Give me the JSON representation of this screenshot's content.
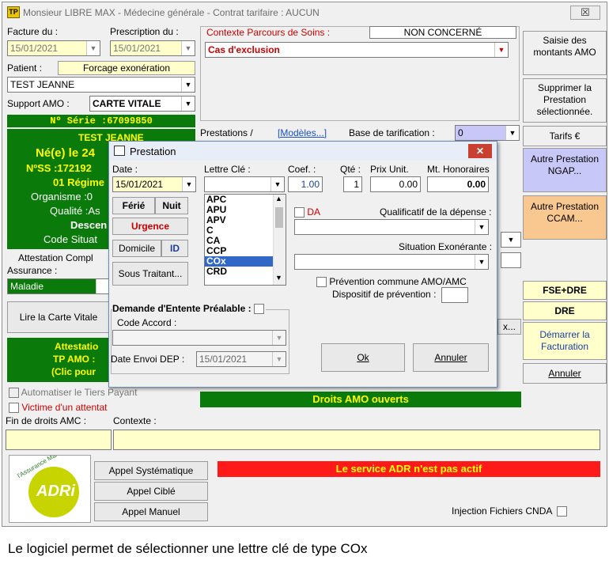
{
  "window": {
    "title": "Monsieur LIBRE MAX - Médecine générale - Contrat tarifaire : AUCUN",
    "close": "☒"
  },
  "left": {
    "facture_label": "Facture du :",
    "facture_value": "15/01/2021",
    "prescription_label": "Prescription du :",
    "prescription_value": "15/01/2021",
    "patient_label": "Patient :",
    "forcage": "Forcage exonération",
    "patient_value": "TEST JEANNE",
    "support_label": "Support AMO :",
    "support_value": "CARTE VITALE",
    "serie": "Nº Série :67099850",
    "green_lines": [
      "TEST JEANNE",
      "Né(e) le 24",
      "NºSS :172192",
      "01 Régime",
      "Organisme :0",
      "Qualité :As",
      "Descen",
      "Code Situat"
    ],
    "attestation": "Attestation Compl",
    "assurance_label": "Assurance :",
    "assurance_value": "Maladie",
    "lire_carte": "Lire la Carte Vitale",
    "attestatio_box": [
      "Attestatio",
      "TP AMO :",
      "(Clic pour"
    ],
    "auto_tiers": "Automatiser le Tiers Payant",
    "victime": "Victime d'un attentat",
    "fin_droits": "Fin de droits AMC :",
    "contexte": "Contexte :"
  },
  "center": {
    "parcours_label": "Contexte Parcours de Soins :",
    "parcours_value": "NON CONCERNÉ",
    "cas_exclusion": "Cas d'exclusion",
    "prestations": "Prestations /",
    "modeles": "[Modèles...]",
    "base_tarif": "Base de tarification :",
    "base_value": "0",
    "droits": "Droits AMO ouverts",
    "modif_btn": "x..."
  },
  "right": {
    "saisie": "Saisie des montants AMO",
    "supprimer": "Supprimer la Prestation sélectionnée.",
    "tarifs": "Tarifs €",
    "autre_ngap": "Autre Prestation NGAP...",
    "autre_ccam": "Autre Prestation CCAM...",
    "fse_dre": "FSE+DRE",
    "dre": "DRE",
    "demarrer": "Démarrer la Facturation",
    "annuler": "Annuler"
  },
  "dialog": {
    "title": "Prestation",
    "close": "✕",
    "date_label": "Date :",
    "date_value": "15/01/2021",
    "lettre_label": "Lettre Clé :",
    "coef_label": "Coef. :",
    "coef_value": "1.00",
    "qte_label": "Qté :",
    "qte_value": "1",
    "prix_label": "Prix Unit.",
    "prix_value": "0.00",
    "mt_label": "Mt. Honoraires",
    "mt_value": "0.00",
    "ferie": "Férié",
    "nuit": "Nuit",
    "urgence": "Urgence",
    "domicile": "Domicile",
    "id": "ID",
    "sous_traitant": "Sous Traitant...",
    "letters": [
      "APC",
      "APU",
      "APV",
      "C",
      "CA",
      "CCP",
      "COx",
      "CRD"
    ],
    "selected_letter": "COx",
    "da": "DA",
    "qualificatif": "Qualificatif de la dépense :",
    "situation": "Situation Exonérante :",
    "prevention": "Prévention commune AMO/AMC",
    "dispositif": "Dispositif de prévention :",
    "entente": "Demande d'Entente Préalable :",
    "code_accord": "Code Accord :",
    "date_envoi_label": "Date Envoi DEP :",
    "date_envoi_value": "15/01/2021",
    "ok": "Ok",
    "annuler": "Annuler"
  },
  "bottom": {
    "appel_sys": "Appel Systématique",
    "appel_cible": "Appel Ciblé",
    "appel_manuel": "Appel Manuel",
    "adr_msg": "Le service ADR n'est pas actif",
    "injection": "Injection Fichiers CNDA",
    "logo_text": "l'Assurance Maladie",
    "logo_adri": "ADRi"
  },
  "caption": "Le logiciel permet de sélectionner une lettre clé de type COx"
}
